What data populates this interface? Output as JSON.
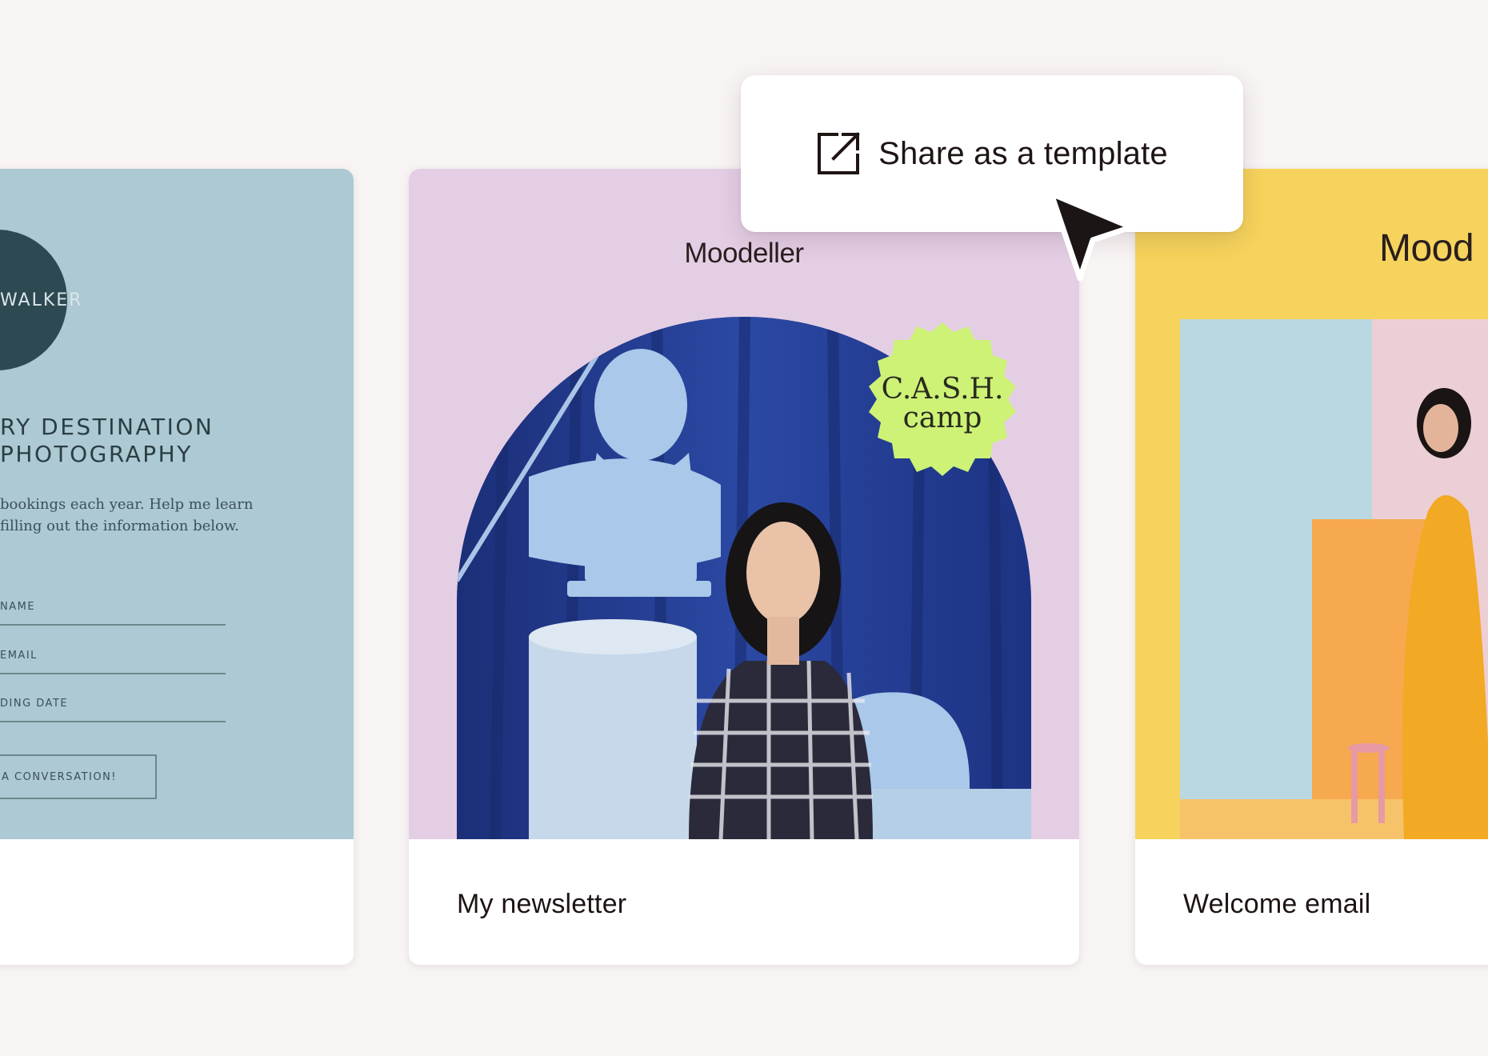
{
  "popover": {
    "share_label": "Share as a template",
    "icon": "external-link-icon"
  },
  "cards": {
    "left": {
      "walker_text": "WALKER",
      "heading": "RY DESTINATION\nPHOTOGRAPHY",
      "intro": "bookings each year. Help me learn\nfilling out the information below.",
      "fields": [
        "NAME",
        "EMAIL",
        "DING DATE"
      ],
      "cta": "A CONVERSATION!"
    },
    "middle": {
      "brand": "Moodeller",
      "badge": "C.A.S.H.\ncamp",
      "title": "My newsletter"
    },
    "right": {
      "brand": "Mood",
      "title": "Welcome email"
    }
  },
  "colors": {
    "background": "#f8f4f4",
    "left_preview": "#adc9d3",
    "middle_preview": "#e4cee4",
    "right_preview": "#f6d35c",
    "badge": "#cdf276",
    "curtain": "#233b8c"
  }
}
